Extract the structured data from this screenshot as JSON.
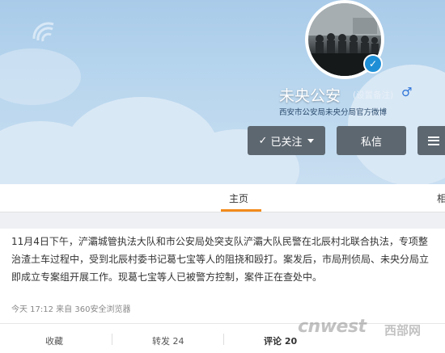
{
  "profile": {
    "name": "未央公安",
    "remark": "(设置备注)",
    "gender_symbol": "♂",
    "verified_symbol": "✓",
    "description": "西安市公安局未央分局官方微博"
  },
  "buttons": {
    "follow_check": "✓",
    "follow_label": "已关注",
    "message_label": "私信"
  },
  "tabs": {
    "home": "主页",
    "right_partial": "相"
  },
  "post": {
    "text": "11月4日下午，浐灞城管执法大队和市公安局处突支队浐灞大队民警在北辰村北联合执法，专项整治渣土车过程中，受到北辰村委书记葛七宝等人的阻挠和殴打。案发后，市局刑侦局、未央分局立即成立专案组开展工作。现葛七宝等人已被警方控制，案件正在查处中。",
    "meta": "今天 17:12 来自 360安全浏览器",
    "actions": {
      "favorite": "收藏",
      "repost": "转发 24",
      "comment": "评论 20"
    }
  },
  "watermark": {
    "text": "cnwest",
    "cn": "西部网"
  },
  "colors": {
    "button_bg": "#5d6770",
    "tab_indicator": "#f28a1b",
    "verify_blue": "#1e8fd6"
  }
}
